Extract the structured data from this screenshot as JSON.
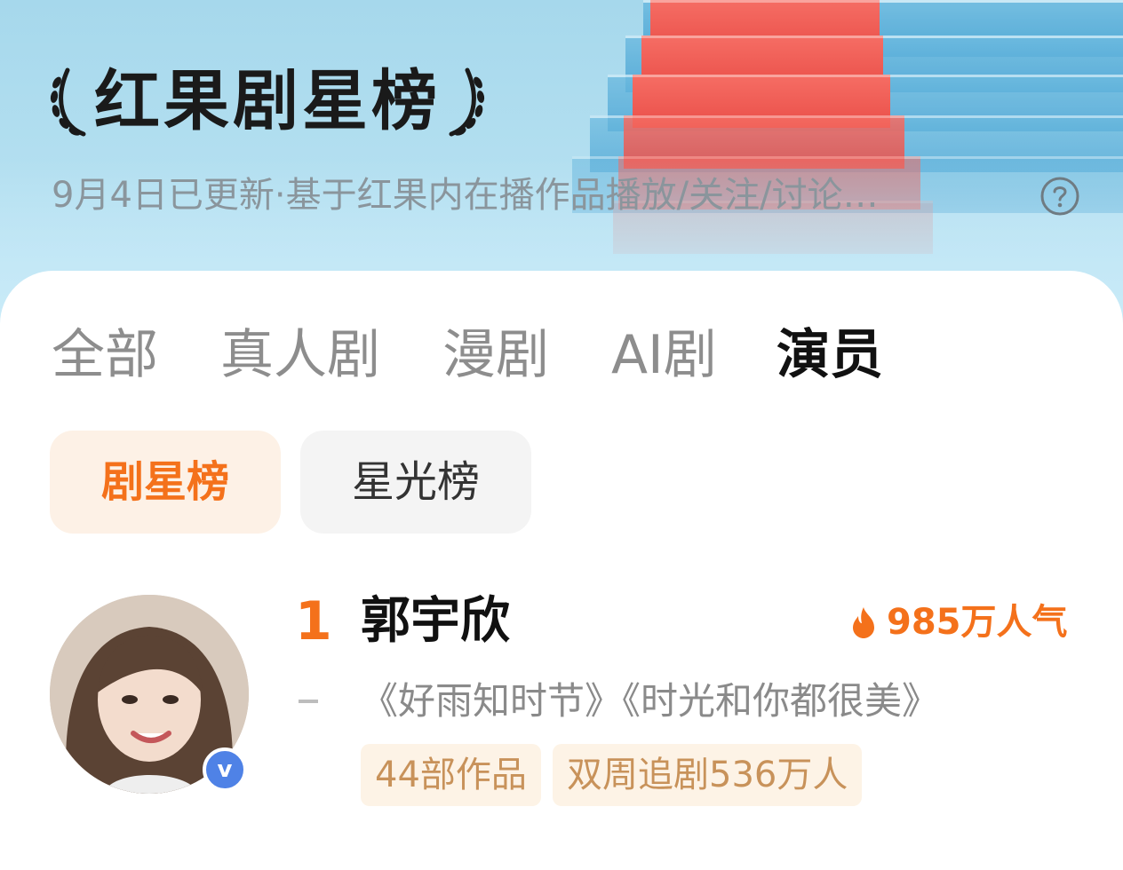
{
  "header": {
    "title": "红果剧星榜",
    "subtitle": "9月4日已更新·基于红果内在播作品播放/关注/讨论…",
    "help_icon": "question-circle-icon",
    "laurel_icon": "laurel-icon"
  },
  "tabs": [
    {
      "label": "全部",
      "active": false
    },
    {
      "label": "真人剧",
      "active": false
    },
    {
      "label": "漫剧",
      "active": false
    },
    {
      "label": "AI剧",
      "active": false
    },
    {
      "label": "演员",
      "active": true
    }
  ],
  "subtabs": [
    {
      "label": "剧星榜",
      "active": true
    },
    {
      "label": "星光榜",
      "active": false
    }
  ],
  "ranking": [
    {
      "rank": "1",
      "name": "郭宇欣",
      "popularity": "985万人气",
      "trend": "-",
      "works": [
        "《好雨知时节》",
        "《时光和你都很美》"
      ],
      "badges": [
        "44部作品",
        "双周追剧536万人"
      ],
      "verified_icon": "verified-v-icon",
      "fire_icon": "flame-icon"
    }
  ],
  "colors": {
    "accent": "#f4711b",
    "badge_bg": "#fdf3e6",
    "badge_text": "#c8925a",
    "chip_active_bg": "#fdf1e6",
    "verified": "#4f82e6",
    "carpet": "#ea4f49",
    "sky": "#a6d8ec"
  }
}
